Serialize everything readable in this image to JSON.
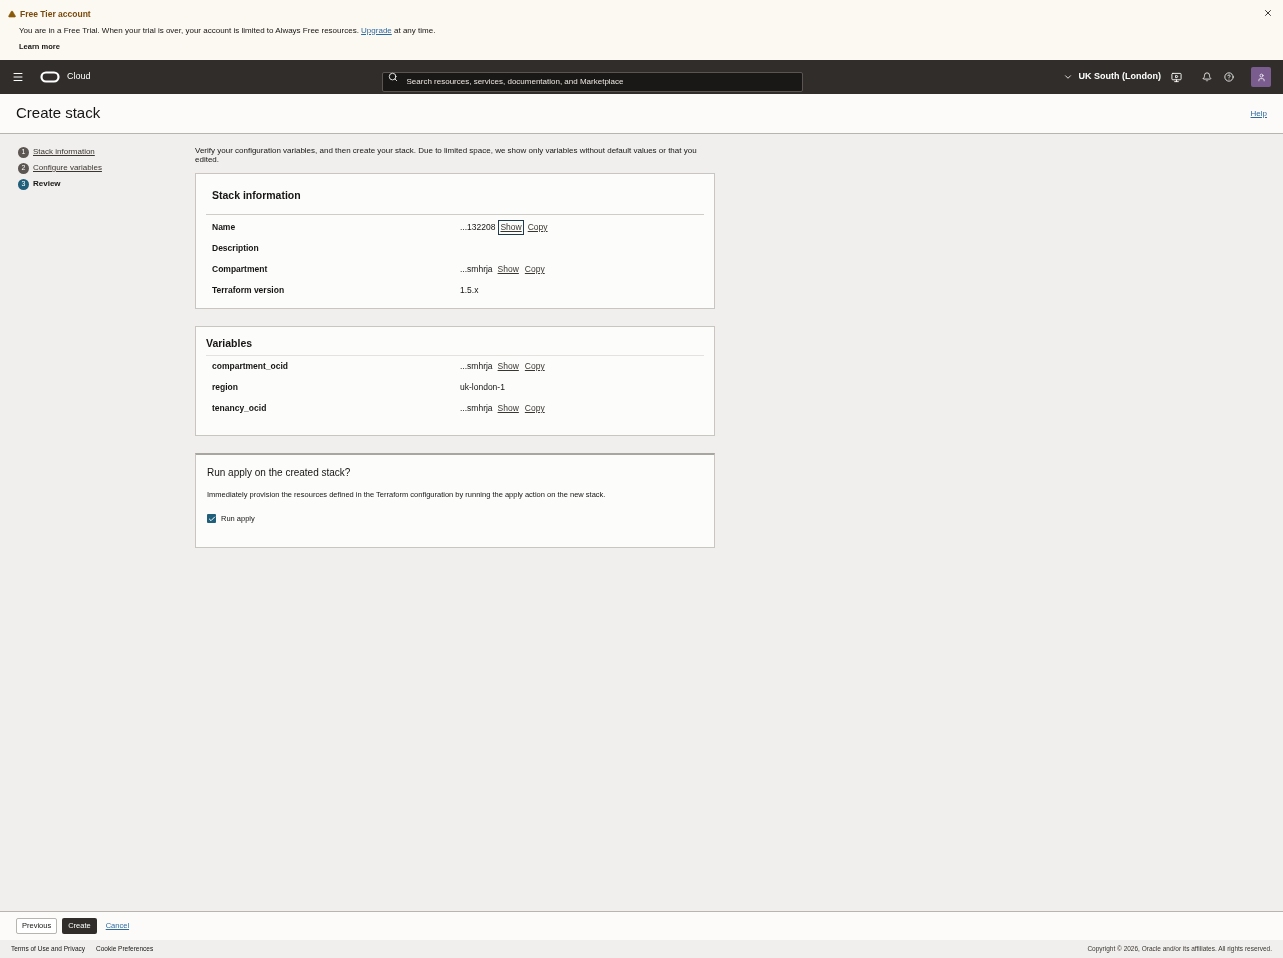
{
  "banner": {
    "title": "Free Tier account",
    "message": "You are in a Free Trial. When your trial is over, your account is limited to Always Free resources.",
    "link": "Upgrade",
    "message_end": "at any time.",
    "learn_more": "Learn more"
  },
  "header": {
    "brand": "Cloud",
    "search": {
      "placeholder": "Search resources, services, documentation, and Marketplace"
    },
    "region": "UK South (London)"
  },
  "page": {
    "title": "Create stack",
    "help": "Help"
  },
  "steps": [
    {
      "number": "1",
      "label": "Stack information",
      "selected": false
    },
    {
      "number": "2",
      "label": "Configure variables",
      "selected": false
    },
    {
      "number": "3",
      "label": "Review",
      "selected": true
    }
  ],
  "intro": "Verify your configuration variables, and then create your stack. Due to limited space, we show only variables without default values or that you edited.",
  "stack_info": {
    "title": "Stack information",
    "rows": [
      {
        "label": "Name",
        "value": "...132208",
        "actions": [
          {
            "label": "Show",
            "focused": true
          },
          {
            "label": "Copy",
            "focused": false
          }
        ]
      },
      {
        "label": "Description"
      },
      {
        "label": "Compartment",
        "value": "...smhrja",
        "actions": [
          {
            "label": "Show",
            "focused": false
          },
          {
            "label": "Copy",
            "focused": false
          }
        ]
      },
      {
        "label": "Terraform version",
        "value": "1.5.x"
      }
    ]
  },
  "variables": {
    "title": "Variables",
    "rows": [
      {
        "label": "compartment_ocid",
        "value": "...smhrja",
        "actions": [
          {
            "label": "Show",
            "focused": false
          },
          {
            "label": "Copy",
            "focused": false
          }
        ]
      },
      {
        "label": "region",
        "value": "uk-london-1"
      },
      {
        "label": "tenancy_ocid",
        "value": "...smhrja",
        "actions": [
          {
            "label": "Show",
            "focused": false
          },
          {
            "label": "Copy",
            "focused": false
          }
        ]
      }
    ]
  },
  "run_apply": {
    "title": "Run apply on the created stack?",
    "description": "Immediately provision the resources defined in the Terraform configuration by running the apply action on the new stack.",
    "checkbox": {
      "label": "Run apply",
      "checked": true
    }
  },
  "actions": {
    "previous": "Previous",
    "create": "Create",
    "cancel": "Cancel"
  },
  "footer": {
    "links": [
      "Terms of Use and Privacy",
      "Cookie Preferences"
    ],
    "copyright": "Copyright © 2026, Oracle and/or its affiliates. All rights reserved."
  }
}
